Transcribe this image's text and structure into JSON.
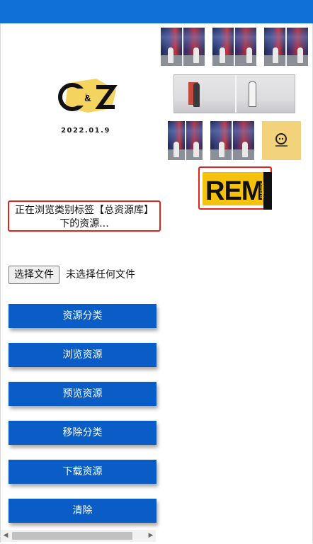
{
  "header": {
    "color": "#1170d6"
  },
  "logo": {
    "text": "C&Z",
    "date": "2022.01.9",
    "accent": "#f4d35e"
  },
  "gallery": {
    "items": [
      {
        "name": "dance-video-1",
        "kind": "dance"
      },
      {
        "name": "dance-video-2",
        "kind": "dance"
      },
      {
        "name": "dance-video-3",
        "kind": "dance"
      },
      {
        "name": "studio-video",
        "kind": "studio"
      },
      {
        "name": "dance-video-4",
        "kind": "dance"
      },
      {
        "name": "dance-video-5",
        "kind": "dance"
      },
      {
        "name": "yellow-logo",
        "kind": "yellow"
      },
      {
        "name": "rem-image",
        "kind": "rem",
        "selected": true
      }
    ],
    "rem_text": "REM",
    "rem_sub": "REMIX",
    "selected_border_color": "#e32219"
  },
  "status": {
    "line1": "正在浏览类别标签【总资源库】",
    "line2": "下的资源..."
  },
  "file_input": {
    "button_label": "选择文件",
    "status_text": "未选择任何文件"
  },
  "actions": [
    {
      "label": "资源分类"
    },
    {
      "label": "浏览资源"
    },
    {
      "label": "预览资源"
    },
    {
      "label": "移除分类"
    },
    {
      "label": "下载资源"
    },
    {
      "label": "清除"
    }
  ],
  "button_color": "#0a5cc6"
}
